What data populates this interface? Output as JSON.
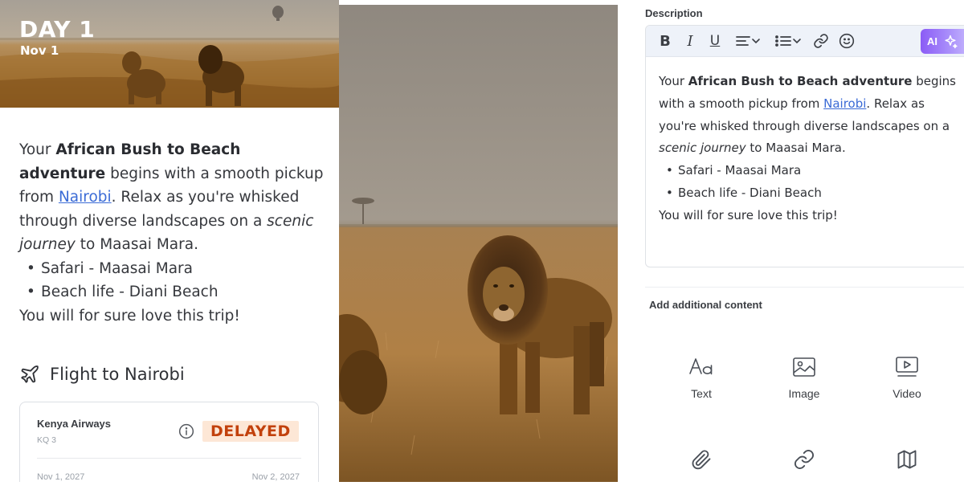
{
  "hero": {
    "day_title": "DAY 1",
    "day_date": "Nov 1"
  },
  "content": {
    "intro_prefix": "Your ",
    "intro_bold": "African Bush to Beach adventure",
    "intro_mid": " begins with a smooth pickup from ",
    "link_text": "Nairobi",
    "intro_after_link": ". Relax as you're whisked through diverse landscapes on a ",
    "italic_text": "scenic journey",
    "intro_end": " to Maasai Mara.",
    "bullets": [
      "Safari - Maasai Mara",
      "Beach life - Diani Beach"
    ],
    "closing": "You will for sure love this trip!"
  },
  "flight": {
    "section_title": "Flight to Nairobi",
    "airline": "Kenya Airways",
    "flight_number": "KQ 3",
    "status": "DELAYED",
    "depart_date": "Nov 1, 2027",
    "arrive_date": "Nov 2, 2027"
  },
  "editor": {
    "label": "Description",
    "toolbar": {
      "bold": "B",
      "italic": "I",
      "underline": "U",
      "ai_label": "AI"
    }
  },
  "additional": {
    "label": "Add additional content",
    "tiles": [
      {
        "label": "Text",
        "icon": "text-type-icon"
      },
      {
        "label": "Image",
        "icon": "image-icon"
      },
      {
        "label": "Video",
        "icon": "video-icon"
      },
      {
        "label": "",
        "icon": "paperclip-icon"
      },
      {
        "label": "",
        "icon": "link-icon"
      },
      {
        "label": "",
        "icon": "map-icon"
      }
    ]
  },
  "colors": {
    "link": "#3b6bd6",
    "delayed_text": "#c2410c",
    "delayed_bg": "#fde7d6",
    "toolbar_bg": "#eef2f9",
    "ai_gradient_start": "#8b5cf6"
  }
}
